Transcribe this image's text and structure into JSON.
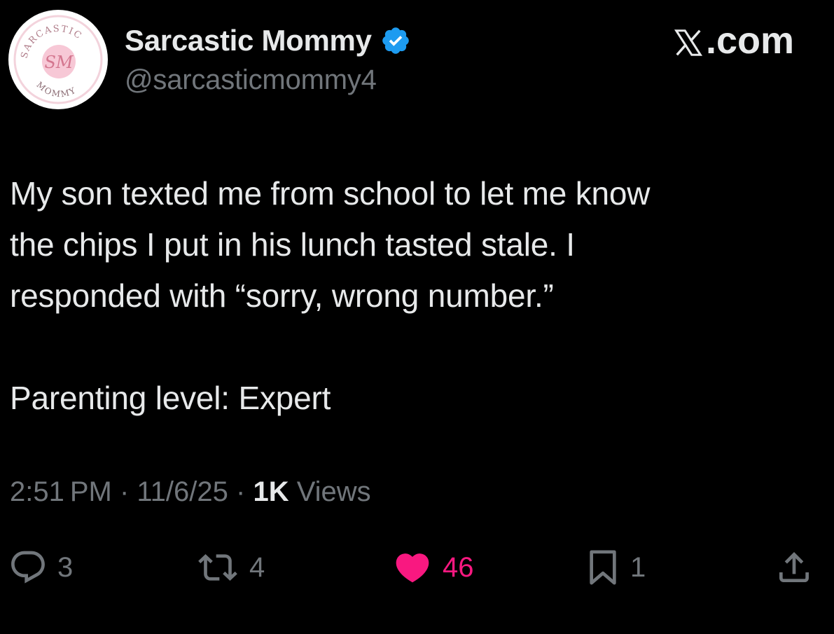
{
  "author": {
    "display_name": "Sarcastic Mommy",
    "handle": "@sarcasticmommy4",
    "verified": true,
    "avatar": {
      "top_text": "SARCASTIC",
      "monogram": "SM",
      "bottom_text": "MOMMY"
    }
  },
  "brand": {
    "label": ".com",
    "icon": "x-logo-icon"
  },
  "tweet": {
    "lines": [
      "My son texted me from school to let me know",
      "the chips I put in his lunch tasted stale. I",
      "responded with “sorry, wrong number.”"
    ],
    "closing": "Parenting level: Expert"
  },
  "meta": {
    "time": "2:51 PM",
    "separator": " · ",
    "date": "11/6/25",
    "views_count": "1K",
    "views_label": " Views"
  },
  "actions": {
    "reply": {
      "icon": "reply-icon",
      "count": "3"
    },
    "repost": {
      "icon": "repost-icon",
      "count": "4"
    },
    "like": {
      "icon": "heart-icon",
      "count": "46",
      "liked": true
    },
    "bookmark": {
      "icon": "bookmark-icon",
      "count": "1"
    },
    "share": {
      "icon": "share-icon"
    }
  },
  "colors": {
    "background": "#000000",
    "primary_text": "#e7e9ea",
    "secondary_text": "#71767b",
    "verified_blue": "#1d9bf0",
    "like_pink": "#f91880",
    "avatar_pink": "#e8a0b4"
  }
}
